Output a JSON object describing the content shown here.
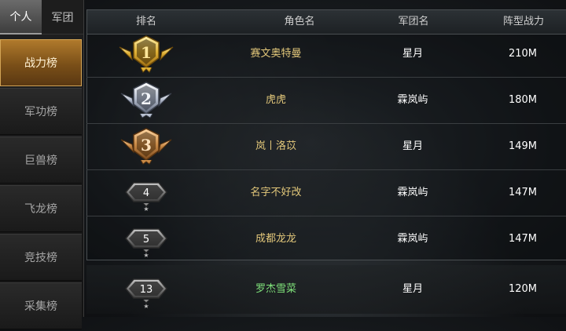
{
  "tabs": {
    "personal": "个人",
    "legion": "军团"
  },
  "sidebar": {
    "items": [
      {
        "label": "战力榜",
        "active": true
      },
      {
        "label": "军功榜",
        "active": false
      },
      {
        "label": "巨兽榜",
        "active": false
      },
      {
        "label": "飞龙榜",
        "active": false
      },
      {
        "label": "竞技榜",
        "active": false
      },
      {
        "label": "采集榜",
        "active": false
      }
    ]
  },
  "table": {
    "headers": {
      "rank": "排名",
      "name": "角色名",
      "legion": "军团名",
      "power": "阵型战力"
    },
    "rows": [
      {
        "rank": "1",
        "name": "赛文奥特曼",
        "legion": "星月",
        "power": "210M",
        "badge": "gold"
      },
      {
        "rank": "2",
        "name": "虎虎",
        "legion": "霖岚屿",
        "power": "180M",
        "badge": "silver"
      },
      {
        "rank": "3",
        "name": "岚丨洛苡",
        "legion": "星月",
        "power": "149M",
        "badge": "bronze"
      },
      {
        "rank": "4",
        "name": "名字不好改",
        "legion": "霖岚屿",
        "power": "147M",
        "badge": "plain"
      },
      {
        "rank": "5",
        "name": "成都龙龙",
        "legion": "霖岚屿",
        "power": "147M",
        "badge": "plain"
      }
    ],
    "self_row": {
      "rank": "13",
      "name": "罗杰雪菜",
      "legion": "星月",
      "power": "120M",
      "badge": "plain"
    }
  },
  "colors": {
    "name_text": "#e2c77a",
    "self_name_text": "#7fe27a",
    "active_tab_gold": "#b07a2c"
  }
}
